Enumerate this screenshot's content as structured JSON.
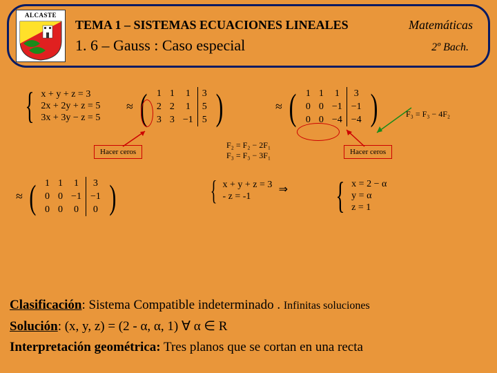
{
  "header": {
    "crest_label": "ALCASTE",
    "tema": "TEMA 1 – SISTEMAS ECUACIONES LINEALES",
    "materia": "Matemáticas",
    "subtitulo": "1. 6 – Gauss : Caso especial",
    "nivel": "2º Bach."
  },
  "system": {
    "eq1": "x + y + z = 3",
    "eq2": "2x + 2y + z = 5",
    "eq3": "3x + 3y − z = 5"
  },
  "matrix1": {
    "rows": [
      [
        "1",
        "1",
        "1",
        "3"
      ],
      [
        "2",
        "2",
        "1",
        "5"
      ],
      [
        "3",
        "3",
        "−1",
        "5"
      ]
    ]
  },
  "matrix2": {
    "rows": [
      [
        "1",
        "1",
        "1",
        "3"
      ],
      [
        "0",
        "0",
        "−1",
        "−1"
      ],
      [
        "0",
        "0",
        "−4",
        "−4"
      ]
    ]
  },
  "ops12": {
    "a": "F₂ = F₂ − 2F₁",
    "b": "F₃ = F₃ − 3F₁"
  },
  "ops23": {
    "a": "F₃ = F₃ − 4F₂"
  },
  "hacer": "Hacer ceros",
  "matrix3": {
    "rows": [
      [
        "1",
        "1",
        "1",
        "3"
      ],
      [
        "0",
        "0",
        "−1",
        "−1"
      ],
      [
        "0",
        "0",
        "0",
        "0"
      ]
    ]
  },
  "reduced_system": {
    "eq1": "x + y + z = 3",
    "eq2": "- z = -1"
  },
  "solution_param": {
    "s1": "x = 2 − α",
    "s2": "y = α",
    "s3": "z = 1"
  },
  "footer": {
    "clasif_lbl": "Clasificación",
    "clasif_txt": ": Sistema Compatible indeterminado . ",
    "clasif_tail": "Infinitas soluciones",
    "sol_lbl": "Solución",
    "sol_txt": ":   (x, y, z) = (2 - α, α, 1)   ∀  α ∈ R",
    "interp_lbl": "Interpretación geométrica:",
    "interp_txt": " Tres planos que se cortan en una recta"
  }
}
